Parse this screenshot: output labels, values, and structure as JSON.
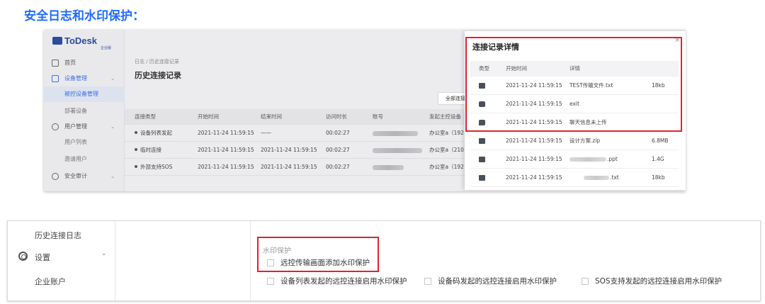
{
  "heading": "安全日志和水印保护：",
  "app": {
    "logo": "ToDesk",
    "logo_sub": "企业版"
  },
  "sidebar": {
    "items": [
      {
        "label": "首页",
        "icon": "home-icon"
      },
      {
        "label": "设备管理",
        "icon": "monitor-icon",
        "chevron": "⌄"
      },
      {
        "label": "被控设备管理"
      },
      {
        "label": "部署设备"
      },
      {
        "label": "用户管理",
        "icon": "user-icon",
        "chevron": "⌄"
      },
      {
        "label": "用户列表"
      },
      {
        "label": "邀请用户"
      },
      {
        "label": "安全审计",
        "icon": "shield-icon",
        "chevron": "⌄"
      }
    ]
  },
  "breadcrumb": "日志 / 历史连接记录",
  "page_title": "历史连接记录",
  "all_connect_button": "全部连接",
  "history_table": {
    "headers": [
      "连接类型",
      "开始时间",
      "结束时间",
      "访问时长",
      "账号",
      "发起主控设备"
    ],
    "rows": [
      {
        "type": "设备列表发起",
        "start": "2021-11-24 11:59:15",
        "end": "——",
        "duration": "00:02:27",
        "device": "办公室a（192"
      },
      {
        "type": "临时连接",
        "start": "2021-11-24 11:59:15",
        "end": "2021-11-24 11:59:15",
        "duration": "00:02:27",
        "device": "办公室a（210"
      },
      {
        "type": "外部支持SOS",
        "start": "2021-11-24 11:59:15",
        "end": "2021-11-24 11:59:15",
        "duration": "00:02:27",
        "device": "办公室a（192"
      }
    ]
  },
  "modal": {
    "title": "连接记录详情",
    "close": "×",
    "headers": [
      "类型",
      "开始时间",
      "详情"
    ],
    "rows": [
      {
        "icon": "folder-icon",
        "time": "2021-11-24 11:59:15",
        "detail": "TEST传输文件.txt",
        "size": "18kb"
      },
      {
        "icon": "terminal-icon",
        "time": "2021-11-24 11:59:15",
        "detail": "exit",
        "size": ""
      },
      {
        "icon": "chat-icon",
        "time": "2021-11-24 11:59:15",
        "detail": "聊天信息未上传",
        "size": ""
      },
      {
        "icon": "folder-icon",
        "time": "2021-11-24 11:59:15",
        "detail": "设计方案.zip",
        "size": "6.8MB"
      },
      {
        "icon": "folder-icon",
        "time": "2021-11-24 11:59:15",
        "detail": ".ppt",
        "size": "1.4G"
      },
      {
        "icon": "folder-icon",
        "time": "2021-11-24 11:59:15",
        "detail": ".txt",
        "size": "18kb"
      }
    ]
  },
  "settings": {
    "sidebar": [
      {
        "label": "历史连接日志"
      },
      {
        "label": "设置",
        "icon": "gear-icon",
        "chevron": "⌄"
      },
      {
        "label": "企业账户"
      }
    ],
    "watermark_label": "水印保护",
    "options": [
      {
        "label": "远控传输画面添加水印保护",
        "checked": false
      },
      {
        "label": "设备列表发起的远控连接启用水印保护",
        "checked": false
      },
      {
        "label": "设备码发起的远控连接启用水印保护",
        "checked": false
      },
      {
        "label": "SOS支持发起的远控连接启用水印保护",
        "checked": false
      }
    ]
  },
  "colors": {
    "accent": "#1e6bff",
    "highlight": "#e4212b",
    "nav_active": "#3a6fe0"
  }
}
